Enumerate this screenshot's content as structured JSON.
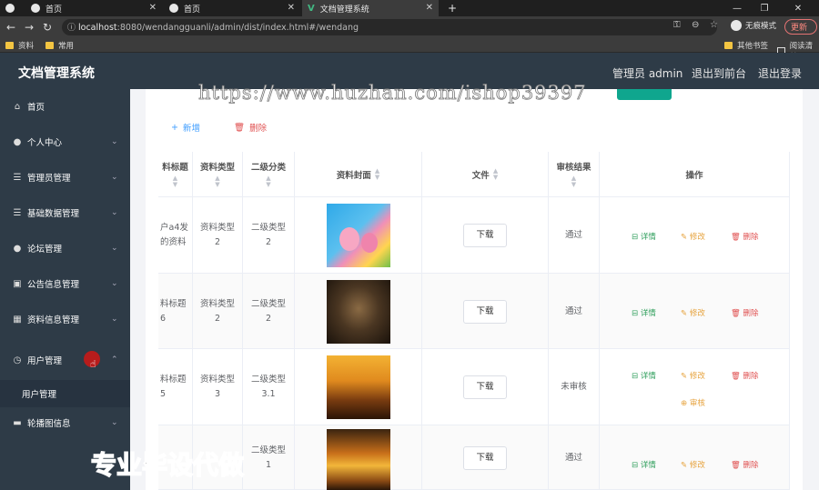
{
  "browser": {
    "tabs": [
      {
        "title": "首页"
      },
      {
        "title": "首页"
      },
      {
        "title": "文档管理系统"
      }
    ],
    "new_tab": "+",
    "url_host": "localhost",
    "url_rest": ":8080/wendangguanli/admin/dist/index.html#/wendang",
    "incognito_label": "无痕模式",
    "update_label": "更新",
    "bookmarks": [
      "资料",
      "常用"
    ],
    "bookmarks_right": [
      "其他书签",
      "阅读清单"
    ]
  },
  "app": {
    "title": "文档管理系统",
    "header_links": [
      "管理员 admin",
      "退出到前台",
      "退出登录"
    ]
  },
  "sidebar": {
    "items": [
      {
        "label": "首页",
        "icon": "home-icon",
        "chevron": false
      },
      {
        "label": "个人中心",
        "icon": "user-icon",
        "chevron": true
      },
      {
        "label": "管理员管理",
        "icon": "list-icon",
        "chevron": true
      },
      {
        "label": "基础数据管理",
        "icon": "list-icon",
        "chevron": true
      },
      {
        "label": "论坛管理",
        "icon": "user-icon",
        "chevron": true
      },
      {
        "label": "公告信息管理",
        "icon": "clipboard-icon",
        "chevron": true
      },
      {
        "label": "资料信息管理",
        "icon": "grid-icon",
        "chevron": true
      },
      {
        "label": "用户管理",
        "icon": "clock-icon",
        "chevron": true,
        "expanded": true
      },
      {
        "label": "轮播图信息",
        "icon": "image-icon",
        "chevron": true
      }
    ],
    "sub_items": [
      "用户管理"
    ]
  },
  "toolbar": {
    "add_label": "新增",
    "delete_label": "删除"
  },
  "table": {
    "headers": [
      "料标题",
      "资料类型",
      "二级分类",
      "资料封面",
      "文件",
      "审核结果",
      "操作"
    ],
    "download_label": "下载",
    "ops": {
      "detail": "详情",
      "edit": "修改",
      "delete": "删除",
      "audit": "审核"
    },
    "rows": [
      {
        "title_l1": "户a4发",
        "title_l2": "的资料",
        "type_l1": "资料类型",
        "type_l2": "2",
        "sub_l1": "二级类型",
        "sub_l2": "2",
        "result": "通过",
        "cover": "peppa"
      },
      {
        "title_l1": "料标题",
        "title_l2": "6",
        "type_l1": "资料类型",
        "type_l2": "2",
        "sub_l1": "二级类型",
        "sub_l2": "2",
        "result": "通过",
        "cover": "dark"
      },
      {
        "title_l1": "料标题",
        "title_l2": "5",
        "type_l1": "资料类型",
        "type_l2": "3",
        "sub_l1": "二级类型",
        "sub_l2": "3.1",
        "result": "未审核",
        "cover": "sunset"
      },
      {
        "title_l1": "",
        "title_l2": "",
        "type_l1": "",
        "type_l2": "",
        "sub_l1": "二级类型",
        "sub_l2": "1",
        "result": "通过",
        "cover": "sunset2"
      }
    ]
  },
  "watermarks": {
    "url": "https://www.huzhan.com/ishop39397",
    "cn": "专业毕设代做"
  },
  "colors": {
    "sidebar_bg": "#2e3b47",
    "accent_green": "#0fa68e",
    "detail": "#2e9e5b",
    "edit": "#e6a23c",
    "delete": "#e05252"
  }
}
